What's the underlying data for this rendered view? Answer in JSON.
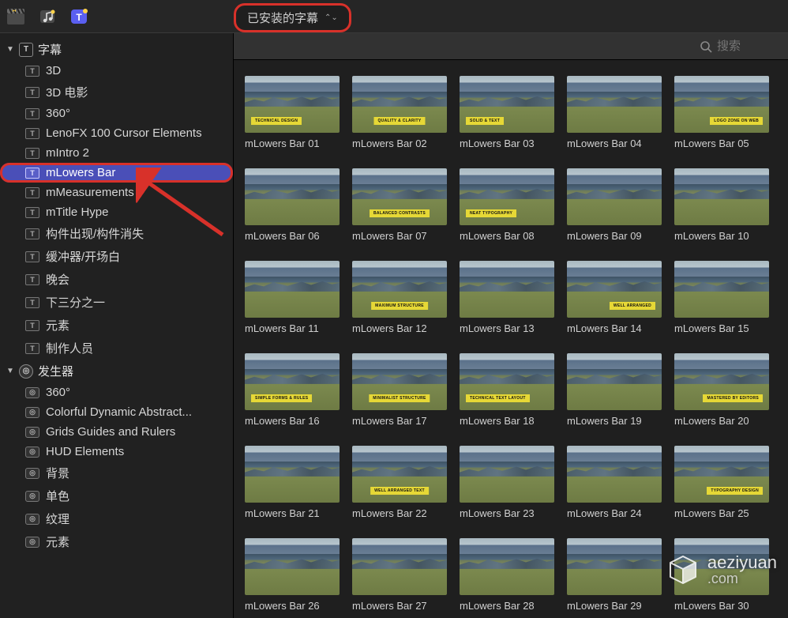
{
  "topbar": {
    "dropdown_label": "已安装的字幕"
  },
  "search": {
    "placeholder": "搜索"
  },
  "sidebar": {
    "categories": [
      {
        "name": "titles",
        "label": "字幕",
        "icon_letter": "T",
        "items": [
          {
            "label": "3D"
          },
          {
            "label": "3D 电影"
          },
          {
            "label": "360°"
          },
          {
            "label": "LenoFX 100 Cursor Elements"
          },
          {
            "label": "mIntro 2"
          },
          {
            "label": "mLowers Bar",
            "selected": true,
            "outlined": true
          },
          {
            "label": "mMeasurements"
          },
          {
            "label": "mTitle Hype"
          },
          {
            "label": "构件出现/构件消失"
          },
          {
            "label": "缓冲器/开场白"
          },
          {
            "label": "晚会"
          },
          {
            "label": "下三分之一"
          },
          {
            "label": "元素"
          },
          {
            "label": "制作人员"
          }
        ]
      },
      {
        "name": "generators",
        "label": "发生器",
        "icon_letter": "◎",
        "items": [
          {
            "label": "360°"
          },
          {
            "label": "Colorful Dynamic Abstract..."
          },
          {
            "label": "Grids Guides and Rulers"
          },
          {
            "label": "HUD Elements"
          },
          {
            "label": "背景"
          },
          {
            "label": "单色"
          },
          {
            "label": "纹理"
          },
          {
            "label": "元素"
          }
        ]
      }
    ]
  },
  "grid": {
    "label_prefix": "mLowers Bar ",
    "items": [
      {
        "n": "01",
        "tag": "TECHNICAL DESIGN",
        "pos": "left"
      },
      {
        "n": "02",
        "tag": "QUALITY & CLARITY",
        "pos": "center"
      },
      {
        "n": "03",
        "tag": "SOLID & TEXT",
        "pos": "left"
      },
      {
        "n": "04",
        "tag": "",
        "pos": "center"
      },
      {
        "n": "05",
        "tag": "LOGO ZONE ON WEB",
        "pos": "right"
      },
      {
        "n": "06",
        "tag": "",
        "pos": "left"
      },
      {
        "n": "07",
        "tag": "BALANCED CONTRASTS",
        "pos": "center"
      },
      {
        "n": "08",
        "tag": "NEAT TYPOGRAPHY",
        "pos": "left"
      },
      {
        "n": "09",
        "tag": "",
        "pos": "center"
      },
      {
        "n": "10",
        "tag": "",
        "pos": "right"
      },
      {
        "n": "11",
        "tag": "",
        "pos": "left"
      },
      {
        "n": "12",
        "tag": "MAXIMUM STRUCTURE",
        "pos": "center"
      },
      {
        "n": "13",
        "tag": "",
        "pos": "left"
      },
      {
        "n": "14",
        "tag": "WELL ARRANGED",
        "pos": "right"
      },
      {
        "n": "15",
        "tag": "",
        "pos": "right"
      },
      {
        "n": "16",
        "tag": "SIMPLE FORMS & RULES",
        "pos": "left"
      },
      {
        "n": "17",
        "tag": "MINIMALIST STRUCTURE",
        "pos": "center"
      },
      {
        "n": "18",
        "tag": "TECHNICAL TEXT LAYOUT",
        "pos": "left"
      },
      {
        "n": "19",
        "tag": "",
        "pos": "center"
      },
      {
        "n": "20",
        "tag": "MASTERED BY EDITORS",
        "pos": "right"
      },
      {
        "n": "21",
        "tag": "",
        "pos": "left"
      },
      {
        "n": "22",
        "tag": "WELL ARRANGED TEXT",
        "pos": "center"
      },
      {
        "n": "23",
        "tag": "",
        "pos": "left"
      },
      {
        "n": "24",
        "tag": "",
        "pos": "center"
      },
      {
        "n": "25",
        "tag": "TYPOGRAPHY DESIGN",
        "pos": "right"
      },
      {
        "n": "26",
        "tag": "",
        "pos": "left"
      },
      {
        "n": "27",
        "tag": "",
        "pos": "center"
      },
      {
        "n": "28",
        "tag": "",
        "pos": "left"
      },
      {
        "n": "29",
        "tag": "",
        "pos": "center"
      },
      {
        "n": "30",
        "tag": "",
        "pos": "right"
      }
    ]
  },
  "watermark": {
    "line1": "aeziyuan",
    "line2": ".com"
  }
}
